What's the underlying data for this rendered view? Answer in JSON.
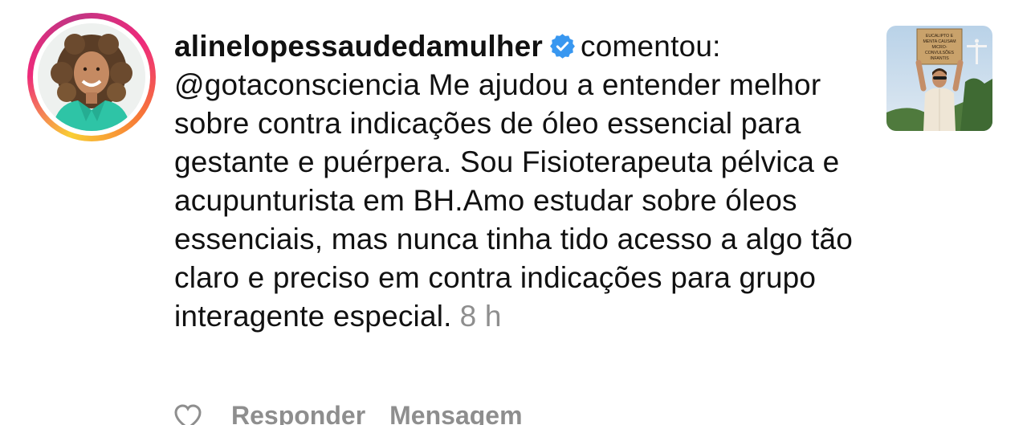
{
  "comment": {
    "username": "alinelopessaudedamulher",
    "verified_icon": "verified-badge-icon",
    "action_word": "comentou:",
    "mention": "@gotaconsciencia",
    "body": " Me ajudou a entender melhor sobre contra indicações de óleo essencial para gestante e puérpera. Sou Fisioterapeuta pélvica e acupunturista em BH.Amo estudar sobre óleos essenciais, mas nunca tinha tido acesso a algo tão claro e preciso em contra indicações para grupo  interagente especial.",
    "time": "8 h"
  },
  "actions": {
    "like_icon": "heart-icon",
    "reply_label": "Responder",
    "message_label": "Mensagem"
  },
  "thumbnail": {
    "sign_lines": [
      "EUCALIPTO E",
      "MENTA CAUSAM",
      "MICRO-",
      "CONVULSÕES",
      "INFANTIS"
    ]
  },
  "colors": {
    "verified_blue": "#3897f0",
    "secondary_text": "#8e8e8e",
    "ring_yellow": "#f9ce34",
    "ring_pink": "#ee2a7b",
    "ring_purple": "#c13584"
  }
}
